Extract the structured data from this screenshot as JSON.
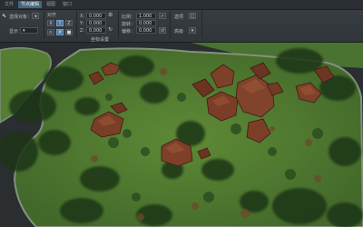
{
  "toolbar": {
    "tabs": [
      "文件",
      "节点编辑",
      "视图",
      "窗口"
    ],
    "panel1": {
      "label1": "选择对象：",
      "label2": "显示",
      "mode_icon": "cursor-icon"
    },
    "panel2": {
      "label": "对齐",
      "btn1": "X",
      "btn2": "Y",
      "btn3": "Z"
    },
    "panel3": {
      "field1_label": "X:",
      "field1_value": "0.000",
      "field2_label": "Y:",
      "field2_value": "0.000",
      "field3_label": "Z:",
      "field3_value": "0.000",
      "section_label": "坐标设置"
    },
    "panel4": {
      "label1": "比例：",
      "field1_value": "1.000",
      "label2": "旋转：",
      "field2_value": "0.000",
      "label3": "偏移：",
      "field3_value": "0.000"
    },
    "panel5": {
      "label1": "选项",
      "label2": "高级"
    }
  },
  "colors": {
    "grass": "#4f7a2e",
    "road": "#2b2f31",
    "rock": "#7a3e26",
    "curb": "#7d8a7a",
    "accent": "#47657e"
  }
}
